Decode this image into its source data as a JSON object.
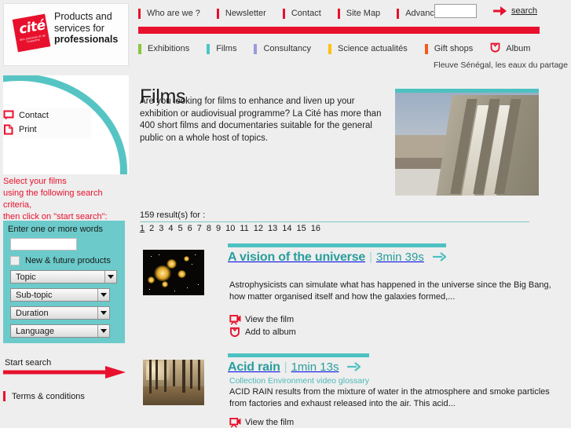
{
  "header": {
    "logo": {
      "mark_text": "cité",
      "mark_subtag": "des sciences et de l'industrie",
      "tagline_line1": "Products and",
      "tagline_line2": "services for",
      "tagline_line3": "professionals"
    },
    "top_nav": [
      {
        "label": "Who are we ?"
      },
      {
        "label": "Newsletter"
      },
      {
        "label": "Contact"
      },
      {
        "label": "Site Map"
      },
      {
        "label": "Advanced"
      }
    ],
    "search": {
      "value": "",
      "placeholder": "",
      "link_label": "search"
    },
    "section_nav": [
      {
        "label": "Exhibitions",
        "color": "#8cc63e"
      },
      {
        "label": "Films",
        "color": "#4dc5c5"
      },
      {
        "label": "Consultancy",
        "color": "#9a9ade"
      },
      {
        "label": "Science actualités",
        "color": "#ffc20e"
      },
      {
        "label": "Gift shops",
        "color": "#f4591c"
      },
      {
        "label": "Album",
        "color": "#e8112d"
      }
    ]
  },
  "sidebar": {
    "quick_links": [
      {
        "label": "Contact",
        "icon": "contact-icon"
      },
      {
        "label": "Print",
        "icon": "print-icon"
      }
    ],
    "instructions_line1": "Select your films",
    "instructions_line2": "using the following search criteria,",
    "instructions_line3": "then click on \"start search\":",
    "filter": {
      "keyword_label": "Enter one or more words",
      "keyword_value": "",
      "keyword_placeholder": "",
      "new_products_label": "New & future products",
      "new_products_checked": false,
      "dropdowns": [
        {
          "label": "Topic"
        },
        {
          "label": "Sub-topic"
        },
        {
          "label": "Duration"
        },
        {
          "label": "Language"
        }
      ]
    },
    "start_search_label": "Start search",
    "terms_label": "Terms & conditions"
  },
  "main": {
    "title": "Films",
    "intro": "Are you looking for films to enhance and liven up your exhibition or audiovisual programme? La Cité has more than 400 short films and documentaries suitable for the general public on a whole host of topics.",
    "hero_caption": "Fleuve Sénégal, les eaux du partage",
    "result_count": "159 result(s) for :",
    "pagination": {
      "pages": [
        "1",
        "2",
        "3",
        "4",
        "5",
        "6",
        "7",
        "8",
        "9",
        "10",
        "11",
        "12",
        "13",
        "14",
        "15",
        "16"
      ],
      "current": "1"
    },
    "results": [
      {
        "title": "A vision of the universe",
        "separator": "|",
        "duration": "3min 39s",
        "collection": "",
        "description": "Astrophysicists can simulate what has happened in the universe since the Big Bang, how matter organised itself and how the galaxies formed,...",
        "actions": [
          {
            "label": "View the film",
            "icon": "video-camera-icon"
          },
          {
            "label": "Add to album",
            "icon": "album-shield-icon"
          }
        ]
      },
      {
        "title": "Acid rain",
        "separator": "|",
        "duration": "1min 13s",
        "collection": "Collection Environment video glossary",
        "description": "ACID RAIN results from the mixture of water in the atmosphere and smoke particles from factories and exhaust released into the air. This acid...",
        "actions": [
          {
            "label": "View the film",
            "icon": "video-camera-icon"
          }
        ]
      }
    ]
  },
  "colors": {
    "brand_red": "#e8112d",
    "teal": "#4dc1c1",
    "teal_dark": "#2a9d9d",
    "panel_teal": "#6ccaca",
    "page_bg": "#eeeeee"
  }
}
